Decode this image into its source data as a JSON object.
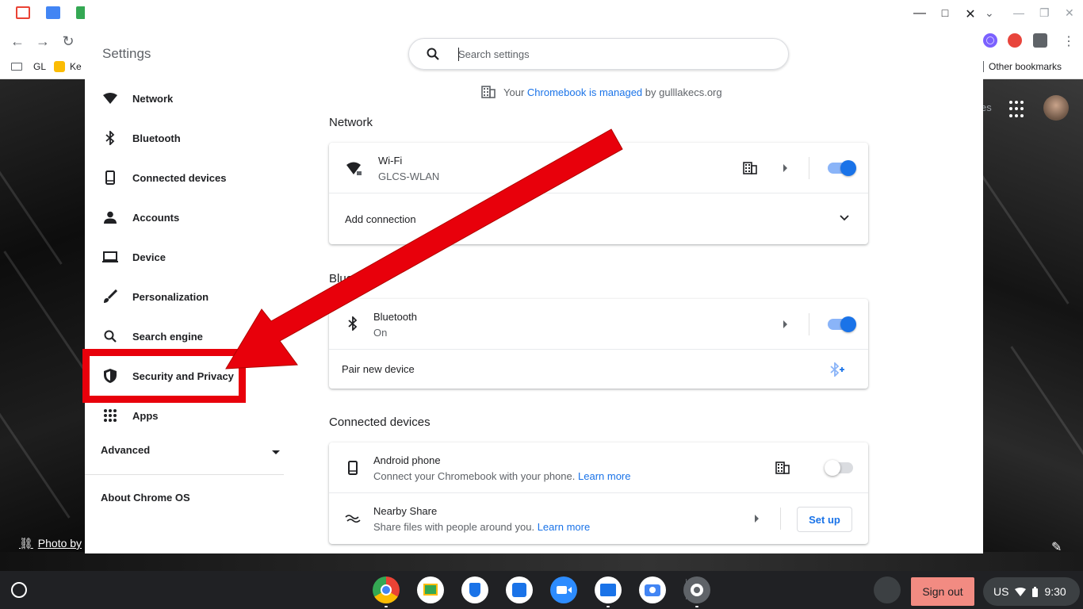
{
  "browser": {
    "bookmarks": [
      {
        "label": "GL"
      },
      {
        "label": "Ke"
      }
    ],
    "other_bookmarks": "Other bookmarks",
    "partial_text": "es"
  },
  "wallpaper": {
    "photo_credit": "Photo by"
  },
  "settings": {
    "title": "Settings",
    "search_placeholder": "Search settings",
    "window_controls": {
      "minimize": "—",
      "maximize": "□",
      "close": "✕"
    },
    "managed": {
      "prefix": "Your",
      "link": "Chromebook is managed",
      "suffix": "by gulllakecs.org"
    },
    "nav": [
      {
        "label": "Network",
        "icon": "wifi-icon"
      },
      {
        "label": "Bluetooth",
        "icon": "bluetooth-icon"
      },
      {
        "label": "Connected devices",
        "icon": "phone-icon"
      },
      {
        "label": "Accounts",
        "icon": "person-icon"
      },
      {
        "label": "Device",
        "icon": "laptop-icon"
      },
      {
        "label": "Personalization",
        "icon": "brush-icon"
      },
      {
        "label": "Search engine",
        "icon": "search-icon"
      },
      {
        "label": "Security and Privacy",
        "icon": "shield-icon"
      },
      {
        "label": "Apps",
        "icon": "apps-grid-icon"
      }
    ],
    "advanced": "Advanced",
    "about": "About Chrome OS",
    "network": {
      "heading": "Network",
      "wifi_title": "Wi-Fi",
      "wifi_network": "GLCS-WLAN",
      "wifi_enabled": true,
      "add_connection": "Add connection"
    },
    "bluetooth": {
      "heading": "Blueto",
      "title": "Bluetooth",
      "status": "On",
      "enabled": true,
      "pair_new": "Pair new device"
    },
    "connected_devices": {
      "heading": "Connected devices",
      "android_title": "Android phone",
      "android_desc": "Connect your Chromebook with your phone.",
      "android_link": "Learn more",
      "android_enabled": false,
      "nearby_title": "Nearby Share",
      "nearby_desc": "Share files with people around you.",
      "nearby_link": "Learn more",
      "setup_label": "Set up"
    }
  },
  "annotation": {
    "color": "#e8000b"
  },
  "shelf": {
    "apps": [
      {
        "name": "chrome-app",
        "color": "#ea4335"
      },
      {
        "name": "classroom-app",
        "color": "#fbbc04"
      },
      {
        "name": "security-app",
        "color": "#1a73e8"
      },
      {
        "name": "notes-app",
        "color": "#1a73e8"
      },
      {
        "name": "zoom-app",
        "color": "#2d8cff"
      },
      {
        "name": "files-app",
        "color": "#1a73e8"
      },
      {
        "name": "camera-app",
        "color": "#4285f4"
      },
      {
        "name": "settings-app",
        "color": "#5f6368"
      }
    ],
    "sign_out": "Sign out",
    "ime": "US",
    "time": "9:30"
  }
}
